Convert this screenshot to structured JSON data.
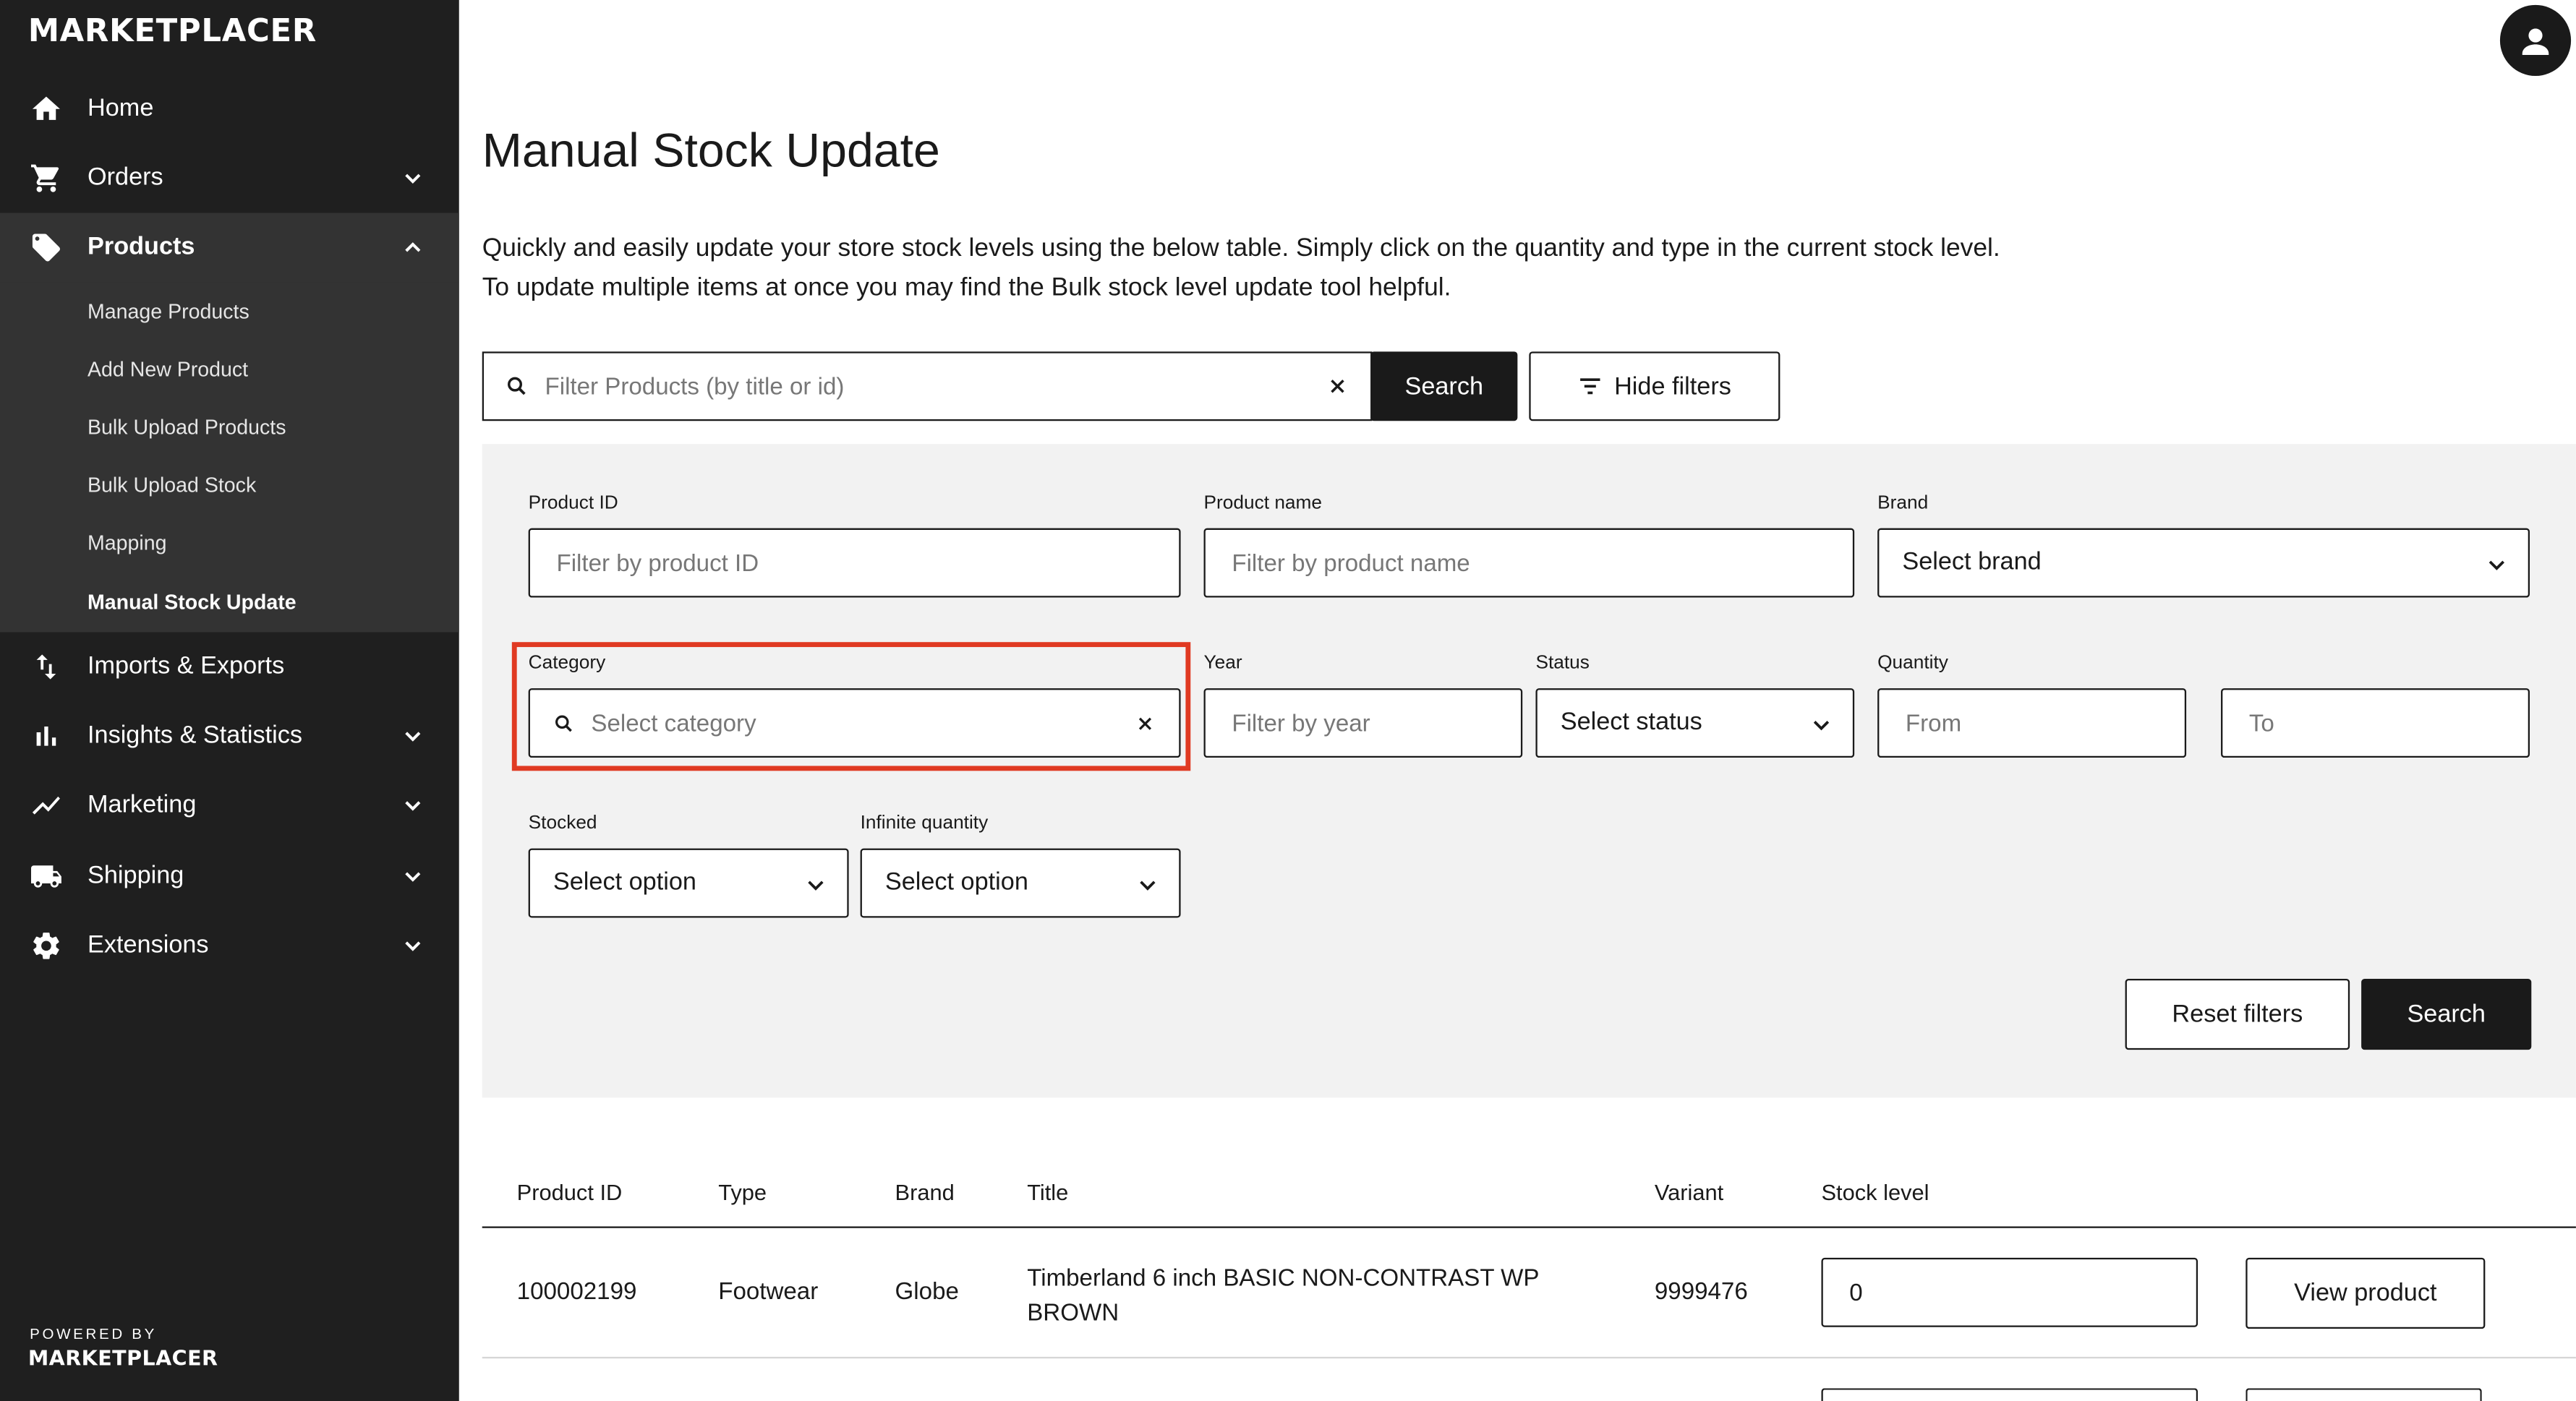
{
  "brand": {
    "logo": "MARKETPLACER",
    "powered_by": "POWERED BY",
    "powered_logo": "MARKETPLACER"
  },
  "sidebar": {
    "items": [
      {
        "label": "Home",
        "icon": "home-icon"
      },
      {
        "label": "Orders",
        "icon": "cart-icon"
      },
      {
        "label": "Products",
        "icon": "tag-icon"
      },
      {
        "label": "Imports & Exports",
        "icon": "import-export-icon"
      },
      {
        "label": "Insights & Statistics",
        "icon": "bar-chart-icon"
      },
      {
        "label": "Marketing",
        "icon": "trend-icon"
      },
      {
        "label": "Shipping",
        "icon": "truck-icon"
      },
      {
        "label": "Extensions",
        "icon": "gear-icon"
      }
    ],
    "products_sub": [
      "Manage Products",
      "Add New Product",
      "Bulk Upload Products",
      "Bulk Upload Stock",
      "Mapping",
      "Manual Stock Update"
    ]
  },
  "page": {
    "title": "Manual Stock Update",
    "intro_line1": "Quickly and easily update your store stock levels using the below table. Simply click on the quantity and type in the current stock level.",
    "intro_line2": "To update multiple items at once you may find the Bulk stock level update tool helpful."
  },
  "search": {
    "placeholder": "Filter Products (by title or id)",
    "button": "Search",
    "hide_filters": "Hide filters"
  },
  "filters": {
    "product_id": {
      "label": "Product ID",
      "placeholder": "Filter by product ID"
    },
    "product_name": {
      "label": "Product name",
      "placeholder": "Filter by product name"
    },
    "brand": {
      "label": "Brand",
      "value": "Select brand"
    },
    "category": {
      "label": "Category",
      "placeholder": "Select category"
    },
    "year": {
      "label": "Year",
      "placeholder": "Filter by year"
    },
    "status": {
      "label": "Status",
      "value": "Select status"
    },
    "quantity": {
      "label": "Quantity",
      "from_placeholder": "From",
      "to_placeholder": "To"
    },
    "stocked": {
      "label": "Stocked",
      "value": "Select option"
    },
    "infinite": {
      "label": "Infinite quantity",
      "value": "Select option"
    },
    "reset": "Reset filters",
    "search": "Search"
  },
  "table": {
    "headers": [
      "Product ID",
      "Type",
      "Brand",
      "Title",
      "Variant",
      "Stock level"
    ],
    "rows": [
      {
        "id": "100002199",
        "type": "Footwear",
        "brand": "Globe",
        "title_line1": "Timberland 6 inch BASIC NON-CONTRAST WP",
        "title_line2": "BROWN",
        "variant": "9999476",
        "stock": "0",
        "action": "View product"
      }
    ]
  },
  "colors": {
    "sidebar": "#1f1f1f",
    "sidebar_active": "#333333",
    "highlight": "#e03a22",
    "panel": "#f2f2f2"
  }
}
